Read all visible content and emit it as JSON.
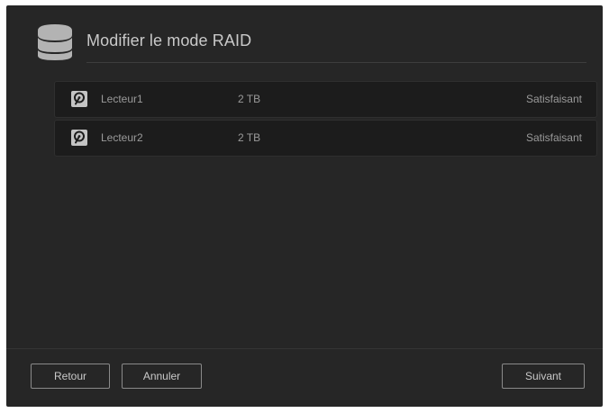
{
  "dialog": {
    "icon": "database-icon",
    "title": "Modifier le mode RAID"
  },
  "drives": [
    {
      "icon": "hard-drive-icon",
      "name": "Lecteur1",
      "size": "2 TB",
      "status": "Satisfaisant"
    },
    {
      "icon": "hard-drive-icon",
      "name": "Lecteur2",
      "size": "2 TB",
      "status": "Satisfaisant"
    }
  ],
  "footer": {
    "back_label": "Retour",
    "cancel_label": "Annuler",
    "next_label": "Suivant"
  },
  "colors": {
    "background": "#262626",
    "row_background": "#1c1c1c",
    "text": "#c9c9c9",
    "muted_text": "#9a9a9a"
  }
}
